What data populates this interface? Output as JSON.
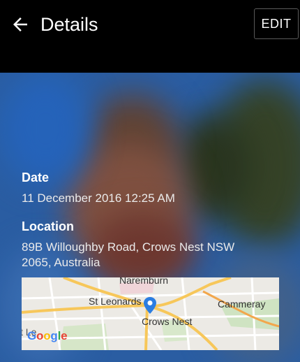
{
  "header": {
    "back_icon": "arrow-left-icon",
    "title": "Details",
    "edit_label": "EDIT"
  },
  "details": {
    "date_label": "Date",
    "date_value": "11 December 2016 12:25 AM",
    "location_label": "Location",
    "location_line1": "89B Willoughby Road, Crows Nest NSW",
    "location_line2": "2065, Australia"
  },
  "map": {
    "places": {
      "naremburn": "Naremburn",
      "st_leonards": "St Leonards",
      "cammeray": "Cammeray",
      "crows_nest": "Crows Nest",
      "partial_left": "t Le"
    },
    "marker_icon": "map-pin-icon",
    "logo_text": "Google",
    "logo_colors": [
      "#4285F4",
      "#EA4335",
      "#FBBC05",
      "#4285F4",
      "#34A853",
      "#EA4335"
    ]
  },
  "colors": {
    "appbar": "#000000",
    "photo_sky": "#2f68b5",
    "map_background": "#eceae5",
    "marker": "#2b7de1"
  }
}
